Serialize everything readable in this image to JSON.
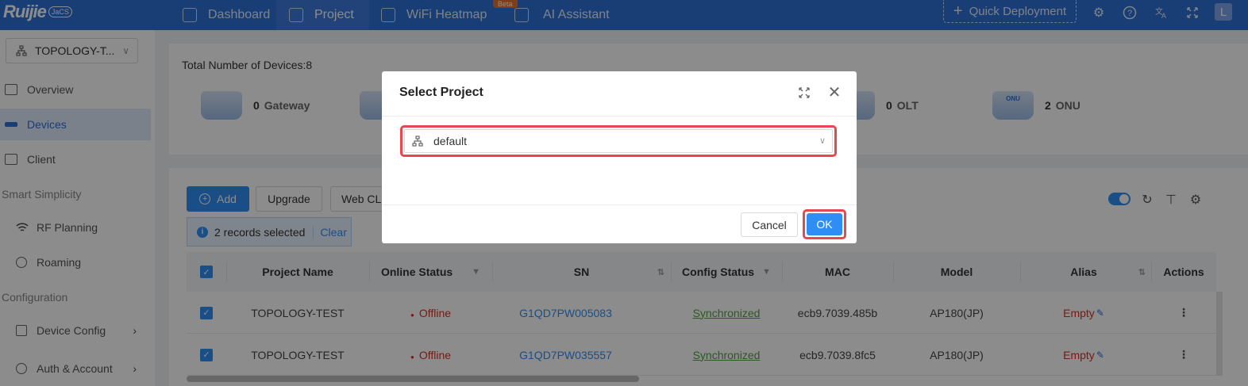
{
  "brand": {
    "logo_text": "Ruijie",
    "badge": "JaCS"
  },
  "nav": [
    {
      "label": "Dashboard",
      "icon": "dashboard-icon"
    },
    {
      "label": "Project",
      "icon": "project-cube-icon"
    },
    {
      "label": "WiFi Heatmap",
      "icon": "heatmap-icon"
    },
    {
      "label": "AI Assistant",
      "icon": "ai-grid-icon"
    }
  ],
  "beta_label": "Beta",
  "quick_deploy": "Quick Deployment",
  "avatar_initial": "L",
  "sidebar": {
    "project_select": "TOPOLOGY-T...",
    "items": [
      {
        "label": "Overview"
      },
      {
        "label": "Devices"
      },
      {
        "label": "Client"
      }
    ],
    "group_smart": "Smart Simplicity",
    "smart_items": [
      {
        "label": "RF Planning"
      },
      {
        "label": "Roaming"
      }
    ],
    "group_config": "Configuration",
    "config_items": [
      {
        "label": "Device Config"
      },
      {
        "label": "Auth & Account"
      }
    ]
  },
  "summary": {
    "total_label": "Total Number of Devices:8",
    "stats": [
      {
        "count": "0",
        "label": "Gateway"
      },
      {
        "count": "0",
        "label": "OLT"
      },
      {
        "count": "2",
        "label": "ONU"
      }
    ]
  },
  "toolbar": {
    "add": "Add",
    "upgrade": "Upgrade",
    "webcli": "Web CLI"
  },
  "selection": {
    "text": "2 records selected",
    "clear": "Clear"
  },
  "table": {
    "headers": [
      "Project Name",
      "Online Status",
      "SN",
      "Config Status",
      "MAC",
      "Model",
      "Alias",
      "Actions"
    ],
    "rows": [
      {
        "project": "TOPOLOGY-TEST",
        "status": "Offline",
        "sn": "G1QD7PW005083",
        "config": "Synchronized",
        "mac": "ecb9.7039.485b",
        "model": "AP180(JP)",
        "alias": "Empty"
      },
      {
        "project": "TOPOLOGY-TEST",
        "status": "Offline",
        "sn": "G1QD7PW035557",
        "config": "Synchronized",
        "mac": "ecb9.7039.8fc5",
        "model": "AP180(JP)",
        "alias": "Empty"
      }
    ]
  },
  "modal": {
    "title": "Select Project",
    "select_value": "default",
    "cancel": "Cancel",
    "ok": "OK"
  },
  "colors": {
    "primary": "#2f8ef5",
    "topbar": "#2f6fd6",
    "offline": "#d93026",
    "synced": "#52a040",
    "highlight": "#e8484d"
  }
}
